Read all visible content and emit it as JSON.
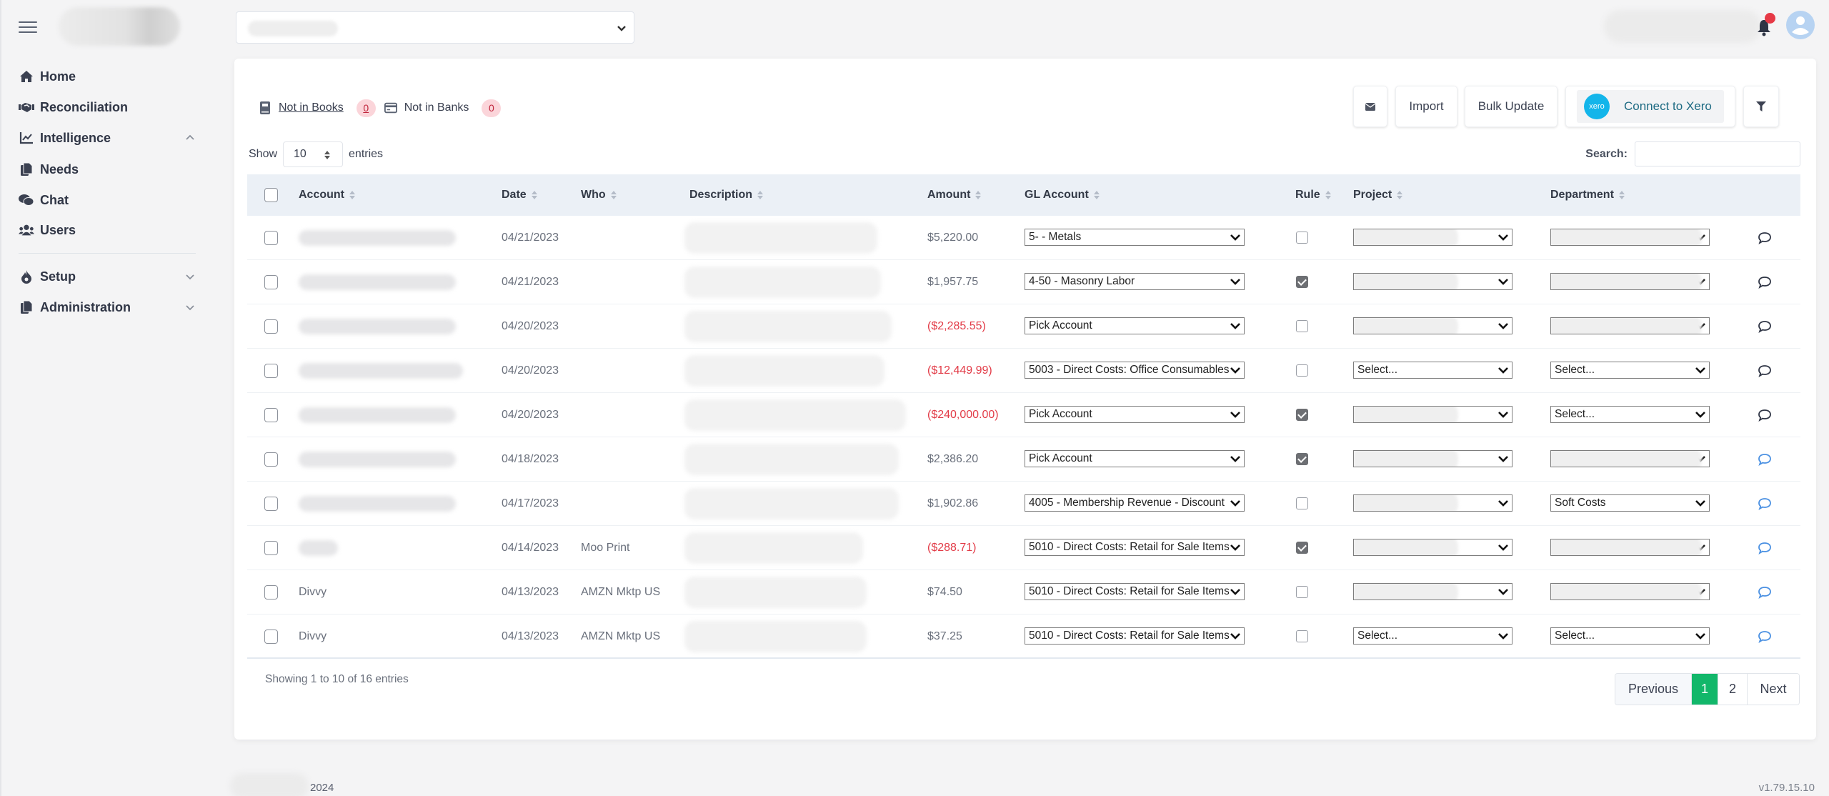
{
  "sidebar": {
    "items": [
      {
        "label": "Home",
        "icon": "home-icon"
      },
      {
        "label": "Reconciliation",
        "icon": "handshake-icon"
      },
      {
        "label": "Intelligence",
        "icon": "chart-line-icon",
        "expanded": true
      },
      {
        "label": "Needs",
        "icon": "copy-icon"
      },
      {
        "label": "Chat",
        "icon": "comments-icon"
      },
      {
        "label": "Users",
        "icon": "users-icon"
      },
      {
        "label": "Setup",
        "icon": "fire-icon",
        "expanded": false
      },
      {
        "label": "Administration",
        "icon": "copy-icon",
        "expanded": false
      }
    ]
  },
  "header": {
    "notification_dot_color": "#e63946"
  },
  "tabs": [
    {
      "label": "Not in Books",
      "count": "0"
    },
    {
      "label": "Not in Banks",
      "count": "0"
    }
  ],
  "toolbar": {
    "import_label": "Import",
    "bulk_update_label": "Bulk Update",
    "xero_logo_text": "xero",
    "xero_label": "Connect to Xero"
  },
  "length": {
    "show_label": "Show",
    "value": "10",
    "entries_label": "entries"
  },
  "search": {
    "label": "Search:",
    "value": ""
  },
  "table": {
    "columns": [
      "Account",
      "Date",
      "Who",
      "Description",
      "Amount",
      "GL Account",
      "Rule",
      "Project",
      "Department"
    ],
    "rows": [
      {
        "account": "",
        "date": "04/21/2023",
        "who": "",
        "amount": "$5,220.00",
        "negative": false,
        "gl": "5- - Metals",
        "rule": false,
        "project": "",
        "department": "",
        "comment_active": false
      },
      {
        "account": "",
        "date": "04/21/2023",
        "who": "",
        "amount": "$1,957.75",
        "negative": false,
        "gl": "4-50 - Masonry Labor",
        "rule": true,
        "project": "",
        "department": "",
        "comment_active": false
      },
      {
        "account": "",
        "date": "04/20/2023",
        "who": "",
        "amount": "($2,285.55)",
        "negative": true,
        "gl": "Pick Account",
        "rule": false,
        "project": "",
        "department": "",
        "comment_active": false
      },
      {
        "account": "",
        "date": "04/20/2023",
        "who": "",
        "amount": "($12,449.99)",
        "negative": true,
        "gl": "5003 - Direct Costs: Office Consumables",
        "rule": false,
        "project": "Select...",
        "department": "Select...",
        "comment_active": false
      },
      {
        "account": "",
        "date": "04/20/2023",
        "who": "",
        "amount": "($240,000.00)",
        "negative": true,
        "gl": "Pick Account",
        "rule": true,
        "project": "",
        "department": "Select...",
        "comment_active": false
      },
      {
        "account": "",
        "date": "04/18/2023",
        "who": "",
        "amount": "$2,386.20",
        "negative": false,
        "gl": "Pick Account",
        "rule": true,
        "project": "",
        "department": "",
        "comment_active": true
      },
      {
        "account": "",
        "date": "04/17/2023",
        "who": "",
        "amount": "$1,902.86",
        "negative": false,
        "gl": "4005 - Membership Revenue - Discount",
        "rule": false,
        "project": "",
        "department": "Soft Costs",
        "comment_active": true
      },
      {
        "account": "",
        "date": "04/14/2023",
        "who": "Moo Print",
        "amount": "($288.71)",
        "negative": true,
        "gl": "5010 - Direct Costs: Retail for Sale Items",
        "rule": true,
        "project": "",
        "department": "",
        "comment_active": true
      },
      {
        "account": "Divvy",
        "date": "04/13/2023",
        "who": "AMZN Mktp US",
        "amount": "$74.50",
        "negative": false,
        "gl": "5010 - Direct Costs: Retail for Sale Items",
        "rule": false,
        "project": "",
        "department": "",
        "comment_active": true
      },
      {
        "account": "Divvy",
        "date": "04/13/2023",
        "who": "AMZN Mktp US",
        "amount": "$37.25",
        "negative": false,
        "gl": "5010 - Direct Costs: Retail for Sale Items",
        "rule": false,
        "project": "Select...",
        "department": "Select...",
        "comment_active": true
      }
    ]
  },
  "info": "Showing 1 to 10 of 16 entries",
  "pagination": {
    "previous": "Previous",
    "pages": [
      "1",
      "2"
    ],
    "current": "1",
    "next": "Next"
  },
  "footer": {
    "year": "2024",
    "version": "v1.79.15.10"
  },
  "colors": {
    "accent_green": "#12b76a",
    "negative": "#e23b47",
    "xero": "#13b5ea",
    "comment_active": "#4a90e2"
  }
}
